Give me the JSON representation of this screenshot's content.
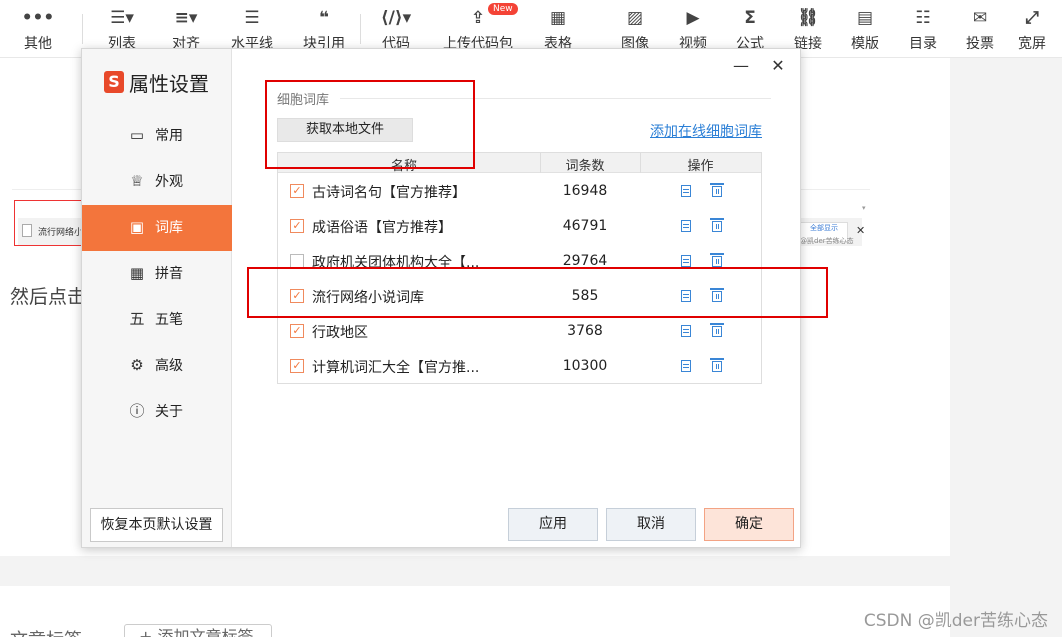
{
  "toolbar": {
    "items": [
      {
        "icon": "•••",
        "label": "其他",
        "name": "more"
      },
      {
        "icon": "☰▾",
        "label": "列表",
        "name": "list"
      },
      {
        "icon": "≡▾",
        "label": "对齐",
        "name": "align"
      },
      {
        "icon": "☰",
        "label": "水平线",
        "name": "hr"
      },
      {
        "icon": "❝",
        "label": "块引用",
        "name": "blockquote"
      },
      {
        "icon": "⟨/⟩▾",
        "label": "代码",
        "name": "code"
      },
      {
        "icon": "⇪",
        "label": "上传代码包",
        "name": "upload-code"
      },
      {
        "icon": "▦",
        "label": "表格",
        "name": "table"
      },
      {
        "icon": "▨",
        "label": "图像",
        "name": "image"
      },
      {
        "icon": "▶",
        "label": "视频",
        "name": "video"
      },
      {
        "icon": "Σ",
        "label": "公式",
        "name": "formula"
      },
      {
        "icon": "⛓",
        "label": "链接",
        "name": "link"
      },
      {
        "icon": "▤",
        "label": "模版",
        "name": "template"
      },
      {
        "icon": "☷",
        "label": "目录",
        "name": "toc"
      },
      {
        "icon": "✉",
        "label": "投票",
        "name": "vote"
      },
      {
        "icon": "⤢",
        "label": "宽屏",
        "name": "widescreen"
      }
    ],
    "new_badge": "New"
  },
  "background": {
    "embedded_row_text": "流行网络小",
    "embedded_right_top": "全部显示",
    "embedded_right_bottom": "@凯der苦练心态",
    "embedded_close": "✕",
    "body_text": "然后点击",
    "bottom_label": "文章标签",
    "bottom_button": "+ 添加文章标签",
    "watermark": "CSDN @凯der苦练心态"
  },
  "dialog": {
    "title": "属性设置",
    "logo_letter": "S",
    "minimize": "—",
    "close": "✕",
    "nav": [
      {
        "icon": "▭",
        "label": "常用",
        "active": false
      },
      {
        "icon": "♕",
        "label": "外观",
        "active": false
      },
      {
        "icon": "▣",
        "label": "词库",
        "active": true
      },
      {
        "icon": "▦",
        "label": "拼音",
        "active": false
      },
      {
        "icon": "五",
        "label": "五笔",
        "active": false
      },
      {
        "icon": "⚙",
        "label": "高级",
        "active": false
      },
      {
        "icon": "ⓘ",
        "label": "关于",
        "active": false
      }
    ],
    "restore_button": "恢复本页默认设置",
    "section_label": "细胞词库",
    "local_button": "获取本地文件",
    "online_link": "添加在线细胞词库",
    "table": {
      "headers": [
        "名称",
        "词条数",
        "操作"
      ],
      "rows": [
        {
          "name": "古诗词名句【官方推荐】",
          "count": "16948",
          "checked": true
        },
        {
          "name": "成语俗语【官方推荐】",
          "count": "46791",
          "checked": true
        },
        {
          "name": "政府机关团体机构大全【...",
          "count": "29764",
          "checked": false
        },
        {
          "name": "流行网络小说词库",
          "count": "585",
          "checked": true
        },
        {
          "name": "行政地区",
          "count": "3768",
          "checked": true
        },
        {
          "name": "计算机词汇大全【官方推...",
          "count": "10300",
          "checked": true
        }
      ]
    },
    "buttons": {
      "apply": "应用",
      "cancel": "取消",
      "ok": "确定"
    },
    "check_mark": "✓"
  },
  "colors": {
    "accent": "#f3753c",
    "link": "#2b7fd6",
    "highlight": "#e00000"
  }
}
